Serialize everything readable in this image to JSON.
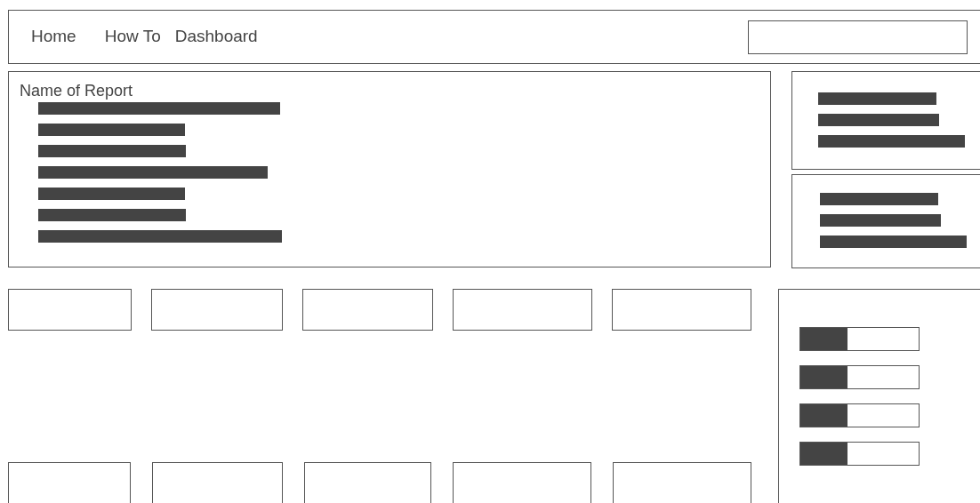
{
  "nav": {
    "links": [
      {
        "label": "Home"
      },
      {
        "label": "How To"
      },
      {
        "label": "Dashboard"
      }
    ]
  },
  "report": {
    "title": "Name of Report"
  },
  "meters": [
    {
      "level": 0.4
    },
    {
      "level": 0.4
    },
    {
      "level": 0.4
    },
    {
      "level": 0.4
    }
  ]
}
